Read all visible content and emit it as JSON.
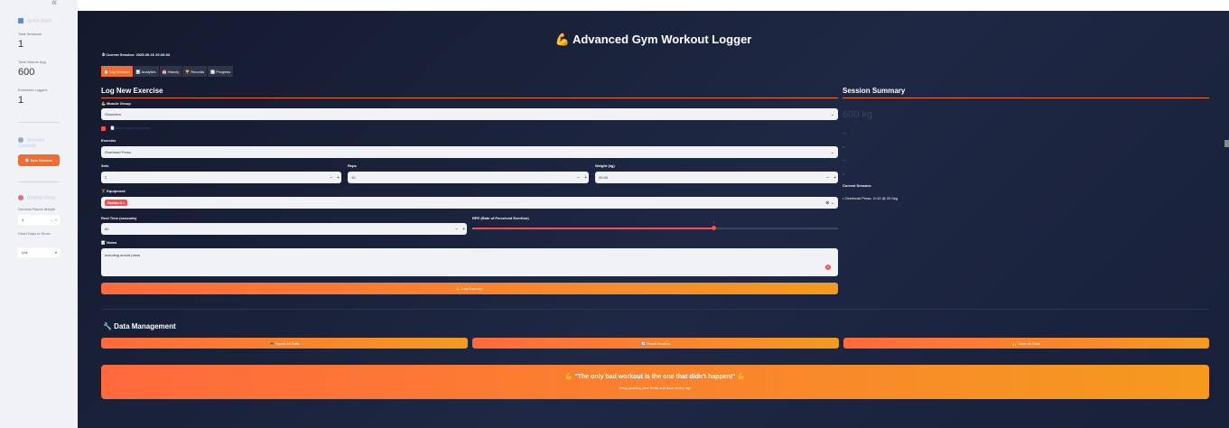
{
  "sidebar": {
    "collapse": "«",
    "quick_stats_heading": "Quick Stats",
    "stats": [
      {
        "label": "Total Sessions",
        "value": "1"
      },
      {
        "label": "Total Volume (kg)",
        "value": "600"
      },
      {
        "label": "Exercises Logged",
        "value": "1"
      }
    ],
    "session_heading": "Session Controls",
    "new_session_button": "🔄 New Session",
    "display_heading": "Display Units",
    "display_inputs": [
      {
        "label": "Decimal Places Weight",
        "value": "4"
      },
      {
        "label": "Chart Days to Show",
        "value": "Lbs"
      }
    ]
  },
  "main": {
    "title": "💪 Advanced Gym Workout Logger",
    "current_session": "⏱ Current Session: 2025-09-16 20:26:03",
    "tabs": [
      "📋 Log Workout",
      "📊 Analytics",
      "📅 History",
      "🏆 Records",
      "📈 Progress"
    ],
    "log_heading": "Log New Exercise",
    "muscle_group_label": "💪 Muscle Group",
    "muscle_group_value": "Shoulders",
    "custom_exercise_label": "Add Custom Exercise",
    "exercise_label": "Exercise",
    "exercise_value": "Overhead Press",
    "sets_label": "Sets",
    "sets_value": "2",
    "reps_label": "Reps",
    "reps_value": "10",
    "weight_label": "Weight (kg)",
    "weight_value": "20.00",
    "equipment_label": "🏋 Equipment",
    "equipment_chip": "Barbbell",
    "rest_label": "Rest Time (seconds)",
    "rest_value": "60",
    "rpe_label": "RPE (Rate of Perceived Exertion)",
    "rpe_value": "7",
    "notes_label": "📝 Notes",
    "notes_value": "Including arnold press",
    "log_button": "💪 Log Exercise",
    "summary_heading": "Session Summary",
    "summary_volume": "600 kg",
    "summary_current_session_label": "Current Session:",
    "summary_current_session_item": "• Overhead Press: 2×10 @ 20.0kg",
    "data_management_heading": "🔧 Data Management",
    "export_button": "📤 Export All Data",
    "reset_button": "🔄 Reset Session",
    "clear_button": "⚠️ Clear All Data",
    "quote": "💪 \"The only bad workout is the one that didn't happen!\" 💪",
    "quote_sub": "Keep pushing your limits and track every rep!"
  },
  "colors": {
    "accent": "#f26b2f",
    "bg": "#1a2136",
    "chip": "#ff4b4b"
  }
}
